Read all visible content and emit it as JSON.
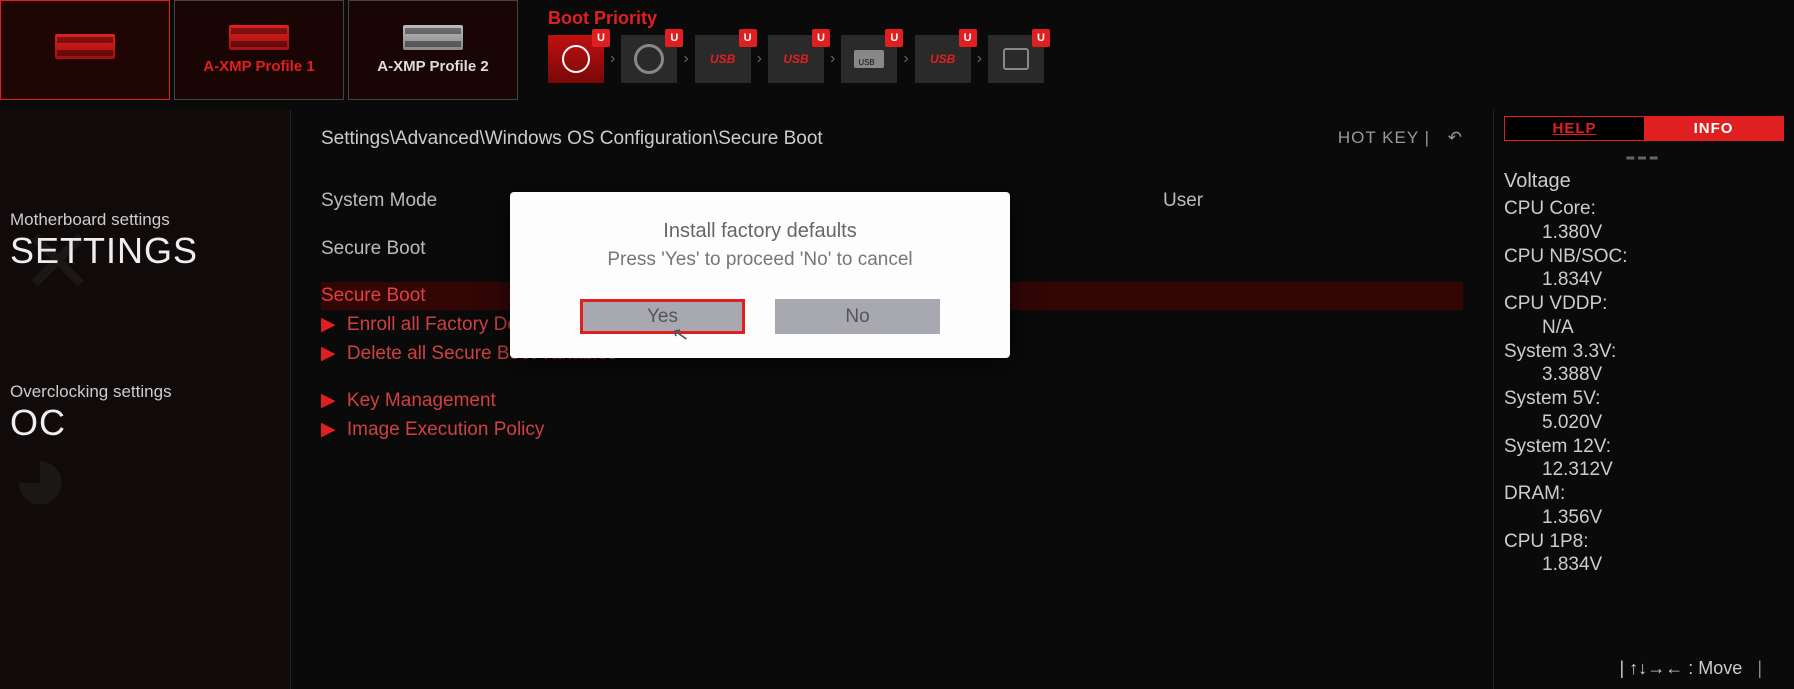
{
  "xmp_tabs": [
    "",
    "A-XMP Profile 1",
    "A-XMP Profile 2"
  ],
  "boot": {
    "title": "Boot Priority",
    "items": [
      {
        "kind": "hdd",
        "badge": "U"
      },
      {
        "kind": "disc",
        "badge": "U"
      },
      {
        "kind": "usb",
        "badge": "U",
        "label": "USB"
      },
      {
        "kind": "usb",
        "badge": "U",
        "label": "USB"
      },
      {
        "kind": "usbdev",
        "badge": "U",
        "label": "USB"
      },
      {
        "kind": "usb",
        "badge": "U",
        "label": "USB"
      },
      {
        "kind": "net",
        "badge": "U"
      }
    ]
  },
  "sidebar": {
    "settings_small": "Motherboard settings",
    "settings_big": "SETTINGS",
    "oc_small": "Overclocking settings",
    "oc_big": "OC"
  },
  "center": {
    "breadcrumb": "Settings\\Advanced\\Windows OS Configuration\\Secure Boot",
    "hotkey": "HOT KEY",
    "rows": [
      {
        "label": "System Mode",
        "value": "User"
      },
      {
        "label": "Secure Boot",
        "value": ""
      }
    ],
    "links": [
      {
        "label": "Secure Boot",
        "highlight": true
      },
      {
        "label": "Enroll all Factory Default keys"
      },
      {
        "label": "Delete all Secure Boot variables"
      },
      {
        "label": "Key Management",
        "gap": true
      },
      {
        "label": "Image Execution Policy"
      }
    ]
  },
  "dialog": {
    "title": "Install factory defaults",
    "msg": "Press 'Yes' to proceed 'No' to cancel",
    "yes": "Yes",
    "no": "No"
  },
  "right": {
    "tab_help": "HELP",
    "tab_info": "INFO",
    "section": "Voltage",
    "items": [
      {
        "k": "CPU Core:",
        "v": "1.380V"
      },
      {
        "k": "CPU NB/SOC:",
        "v": "1.834V"
      },
      {
        "k": "CPU VDDP:",
        "v": "N/A"
      },
      {
        "k": "System 3.3V:",
        "v": "3.388V"
      },
      {
        "k": "System 5V:",
        "v": "5.020V"
      },
      {
        "k": "System 12V:",
        "v": "12.312V"
      },
      {
        "k": "DRAM:",
        "v": "1.356V"
      },
      {
        "k": "CPU 1P8:",
        "v": "1.834V"
      }
    ]
  },
  "bottom": {
    "arrows": "↑↓→←",
    "move": ": Move"
  }
}
